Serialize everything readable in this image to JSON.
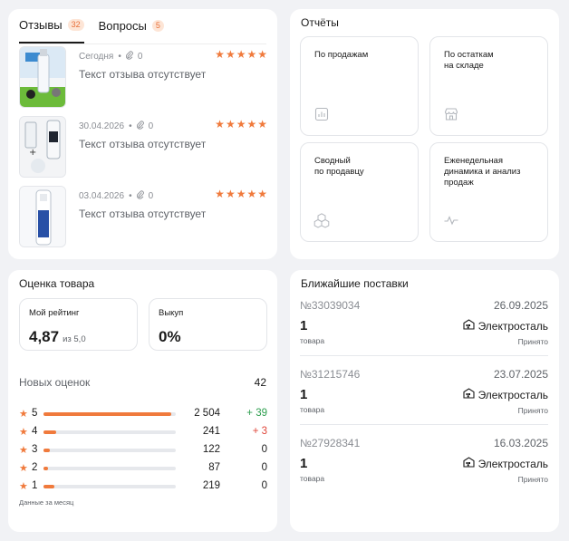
{
  "reviews": {
    "tabs": [
      {
        "label": "Отзывы",
        "badge": "32"
      },
      {
        "label": "Вопросы",
        "badge": "5"
      }
    ],
    "items": [
      {
        "date": "Сегодня",
        "attachments": "0",
        "text": "Текст отзыва отсутствует",
        "rating": 5
      },
      {
        "date": "30.04.2026",
        "attachments": "0",
        "text": "Текст отзыва отсутствует",
        "rating": 5
      },
      {
        "date": "03.04.2026",
        "attachments": "0",
        "text": "Текст отзыва отсутствует",
        "rating": 5
      }
    ]
  },
  "reports": {
    "title": "Отчёты",
    "items": [
      {
        "label": "По продажам",
        "icon": "chart-icon"
      },
      {
        "label": "По остаткам\nна складе",
        "icon": "store-icon"
      },
      {
        "label": "Сводный\nпо продавцу",
        "icon": "boxes-icon"
      },
      {
        "label": "Еженедельная\nдинамика и анализ\nпродаж",
        "icon": "pulse-icon"
      }
    ]
  },
  "rating": {
    "title": "Оценка товара",
    "my_rating_label": "Мой рейтинг",
    "my_rating_value": "4,87",
    "my_rating_suffix": "из 5,0",
    "buyout_label": "Выкуп",
    "buyout_value": "0%",
    "new_label": "Новых оценок",
    "new_value": "42",
    "distribution": [
      {
        "stars": "5",
        "count": "2 504",
        "delta": "+ 39",
        "share": 0.965
      },
      {
        "stars": "4",
        "count": "241",
        "delta": "+ 3",
        "share": 0.093
      },
      {
        "stars": "3",
        "count": "122",
        "delta": "0",
        "share": 0.047
      },
      {
        "stars": "2",
        "count": "87",
        "delta": "0",
        "share": 0.034
      },
      {
        "stars": "1",
        "count": "219",
        "delta": "0",
        "share": 0.084
      }
    ],
    "footnote": "Данные за месяц"
  },
  "supplies": {
    "title": "Ближайшие поставки",
    "items": [
      {
        "id": "№33039034",
        "date": "26.09.2025",
        "qty": "1",
        "unit": "товара",
        "warehouse": "Электросталь",
        "status": "Принято"
      },
      {
        "id": "№31215746",
        "date": "23.07.2025",
        "qty": "1",
        "unit": "товара",
        "warehouse": "Электросталь",
        "status": "Принято"
      },
      {
        "id": "№27928341",
        "date": "16.03.2025",
        "qty": "1",
        "unit": "товара",
        "warehouse": "Электросталь",
        "status": "Принято"
      }
    ]
  },
  "colors": {
    "accent": "#f07a3c",
    "positive": "#2e9e4f",
    "negative": "#e0463a"
  }
}
